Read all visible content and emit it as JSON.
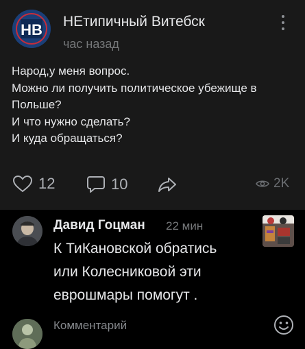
{
  "post": {
    "group_name": "НЕтипичный Витебск",
    "time": "час назад",
    "avatar_letters": "НВ",
    "text_lines": [
      "Народ,у меня вопрос.",
      "Можно ли получить политическое убежище в",
      "Польше?",
      "И что нужно сделать?",
      "И куда обращаться?"
    ],
    "likes": "12",
    "comments": "10",
    "views": "2K"
  },
  "comment": {
    "author": "Давид Гоцман",
    "time": "22 мин",
    "text_lines": [
      "К ТиКановской обратись",
      "или Колесниковой эти",
      "еврошмары помогут ."
    ]
  },
  "composer": {
    "placeholder": "Комментарий"
  },
  "colors": {
    "background": "#000000",
    "card": "#191919",
    "text": "#e6e7e9",
    "secondary": "#76787a"
  },
  "icons": [
    "more-vertical-icon",
    "heart-icon",
    "comment-icon",
    "share-icon",
    "eye-icon",
    "emoji-icon"
  ]
}
